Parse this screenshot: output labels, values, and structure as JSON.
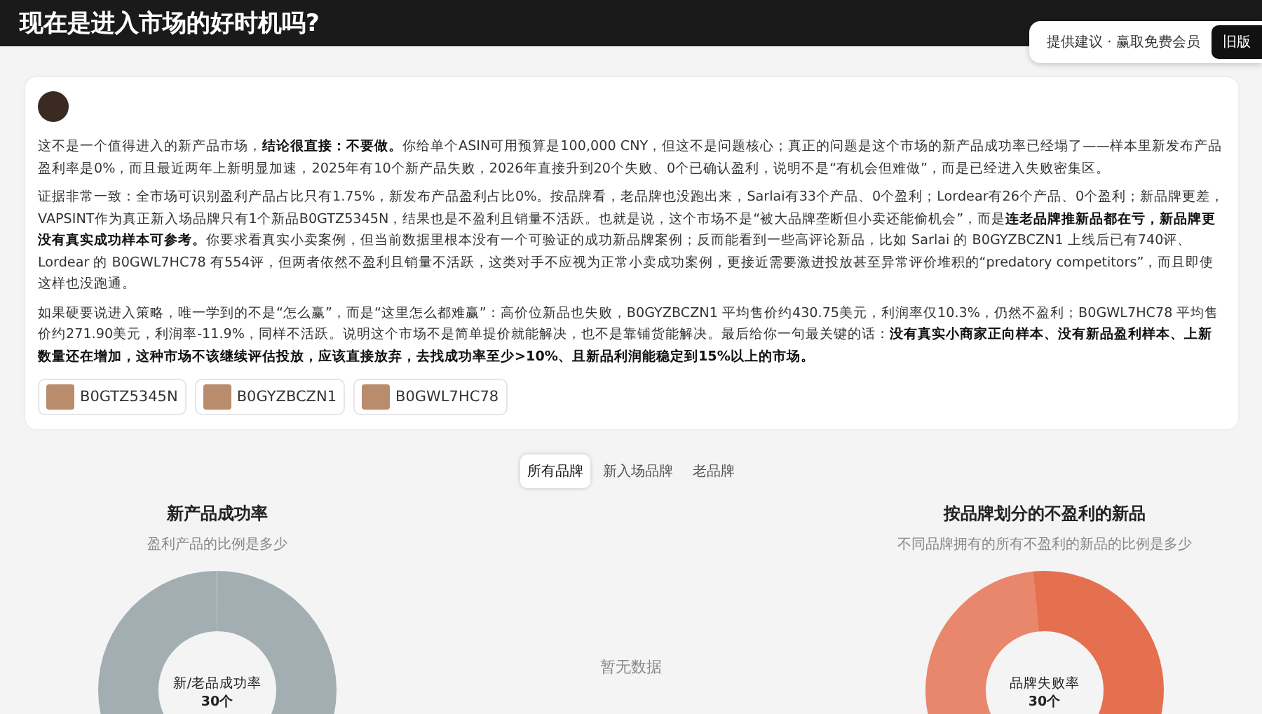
{
  "header": {
    "title": "现在是进入市场的好时机吗?"
  },
  "popover": {
    "feedback": "提供建议 · 赢取免费会员",
    "old_version_button": "旧版"
  },
  "answer": {
    "paragraphs": [
      "这不是一个值得进入的新产品市场，**结论很直接：不要做。**你给单个ASIN可用预算是100,000 CNY，但这不是问题核心；真正的问题是这个市场的新产品成功率已经塌了——样本里新发布产品盈利率是0%，而且最近两年上新明显加速，2025年有10个新产品失败，2026年直接升到20个失败、0个已确认盈利，说明不是“有机会但难做”，而是已经进入失败密集区。",
      "证据非常一致：全市场可识别盈利产品占比只有1.75%，新发布产品盈利占比0%。按品牌看，老品牌也没跑出来，Sarlai有33个产品、0个盈利；Lordear有26个产品、0个盈利；新品牌更差，VAPSINT作为真正新入场品牌只有1个新品B0GTZ5345N，结果也是不盈利且销量不活跃。也就是说，这个市场不是“被大品牌垄断但小卖还能偷机会”，而是**连老品牌推新品都在亏，新品牌更没有真实成功样本可参考。**你要求看真实小卖案例，但当前数据里根本没有一个可验证的成功新品牌案例；反而能看到一些高评论新品，比如 Sarlai 的 B0GYZBCZN1 上线后已有740评、Lordear 的 B0GWL7HC78 有554评，但两者依然不盈利且销量不活跃，这类对手不应视为正常小卖成功案例，更接近需要激进投放甚至异常评价堆积的“predatory competitors”，而且即使这样也没跑通。",
      "如果硬要说进入策略，唯一学到的不是“怎么赢”，而是“这里怎么都难赢”：高价位新品也失败，B0GYZBCZN1 平均售价约430.75美元，利润率仅10.3%，仍然不盈利；B0GWL7HC78 平均售价约271.90美元，利润率-11.9%，同样不活跃。说明这个市场不是简单提价就能解决，也不是靠铺货能解决。最后给你一句最关键的话：**没有真实小商家正向样本、没有新品盈利样本、上新数量还在增加，这种市场不该继续评估投放，应该直接放弃，去找成功率至少>10%、且新品利润能稳定到15%以上的市场。**"
    ],
    "products": [
      {
        "asin": "B0GTZ5345N"
      },
      {
        "asin": "B0GYZBCZN1"
      },
      {
        "asin": "B0GWL7HC78"
      }
    ]
  },
  "brand_tabs": [
    {
      "label": "所有品牌",
      "selected": true
    },
    {
      "label": "新入场品牌",
      "selected": false
    },
    {
      "label": "老品牌",
      "selected": false
    }
  ],
  "panels": [
    {
      "kind": "donut",
      "title": "新产品成功率",
      "subtitle": "盈利产品的比例是多少",
      "center_label": "新/老品成功率",
      "center_value": "30个"
    },
    {
      "kind": "empty",
      "message": "暂无数据"
    },
    {
      "kind": "donut",
      "title": "按品牌划分的不盈利的新品",
      "subtitle": "不同品牌拥有的所有不盈利的新品的比例是多少",
      "center_label": "品牌失败率",
      "center_value": "30个"
    }
  ]
}
